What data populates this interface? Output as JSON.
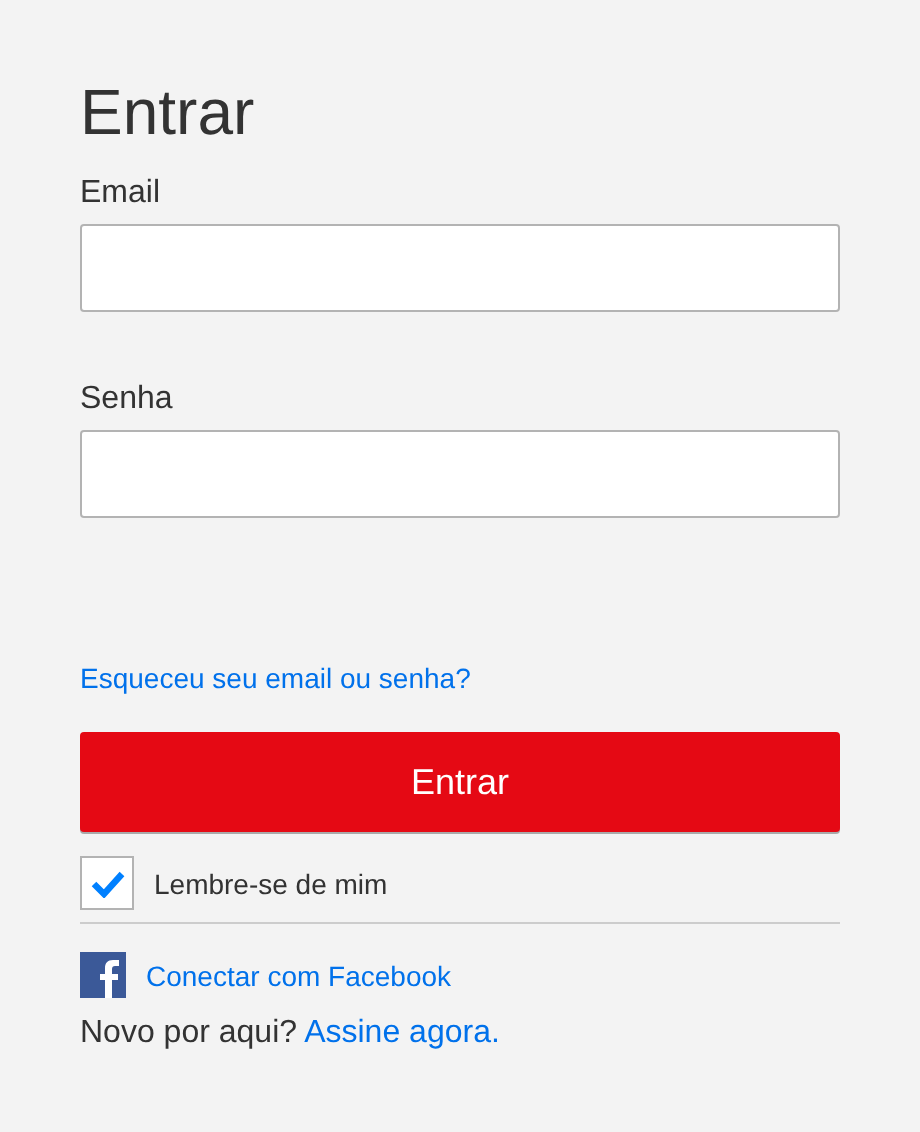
{
  "title": "Entrar",
  "fields": [
    {
      "label": "Email"
    },
    {
      "label": "Senha"
    }
  ],
  "forgot_link": "Esqueceu seu email ou senha?",
  "submit_button": "Entrar",
  "remember": {
    "label": "Lembre-se de mim",
    "checked": true
  },
  "facebook_link": "Conectar com Facebook",
  "signup": {
    "text": "Novo por aqui?",
    "link": "Assine agora."
  }
}
